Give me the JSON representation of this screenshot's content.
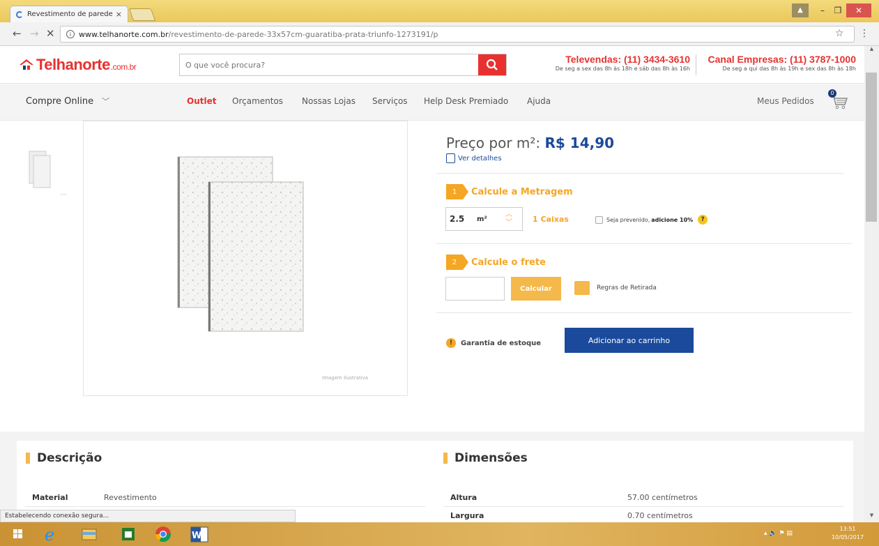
{
  "browser": {
    "tab_title": "Revestimento de parede",
    "tab_close": "×",
    "url_host": "www.telhanorte.com.br",
    "url_path": "/revestimento-de-parede-33x57cm-guaratiba-prata-triunfo-1273191/p",
    "status_text": "Estabelecendo conexão segura..."
  },
  "header": {
    "logo_main": "Telhanorte",
    "logo_suffix": ".com.br",
    "search_placeholder": "O que você procura?",
    "televendas_title": "Televendas: (11) 3434-3610",
    "televendas_hours": "De seg a sex das 8h às 18h e sáb das 8h às 16h",
    "empresas_title": "Canal Empresas: (11) 3787-1000",
    "empresas_hours": "De seg a qui das 8h às 19h e sex das 8h às 18h"
  },
  "nav": {
    "compre_online": "Compre Online",
    "items": [
      "Outlet",
      "Orçamentos",
      "Nossas Lojas",
      "Serviços",
      "Help Desk Premiado",
      "Ajuda"
    ],
    "meus_pedidos": "Meus Pedidos",
    "cart_count": "0"
  },
  "gallery": {
    "caption": "Imagem Ilustrativa"
  },
  "product": {
    "price_label": "Preço por m²:",
    "price_value": "R$ 14,90",
    "ver_detalhes": "Ver detalhes",
    "step1_num": "1",
    "step1_title": "Calcule a Metragem",
    "qty_value": "2.5",
    "qty_unit": "m²",
    "caixas": "1 Caixas",
    "prevenido_text": "Seja prevenido,",
    "prevenido_bold": "adicione 10%",
    "help": "?",
    "step2_num": "2",
    "step2_title": "Calcule o frete",
    "calcular": "Calcular",
    "regras": "Regras de Retirada",
    "garantia": "Garantia de estoque",
    "add_cart": "Adicionar ao carrinho"
  },
  "description": {
    "title": "Descrição",
    "rows": [
      {
        "label": "Material",
        "value": "Revestimento"
      }
    ]
  },
  "dimensions": {
    "title": "Dimensões",
    "rows": [
      {
        "label": "Altura",
        "value": "57.00 centímetros"
      },
      {
        "label": "Largura",
        "value": "0.70 centímetros"
      }
    ]
  },
  "taskbar": {
    "time": "13:51",
    "date": "10/05/2017"
  },
  "colors": {
    "brand_red": "#e8312f",
    "brand_blue": "#1b4a9c",
    "accent_orange": "#f5a623"
  }
}
